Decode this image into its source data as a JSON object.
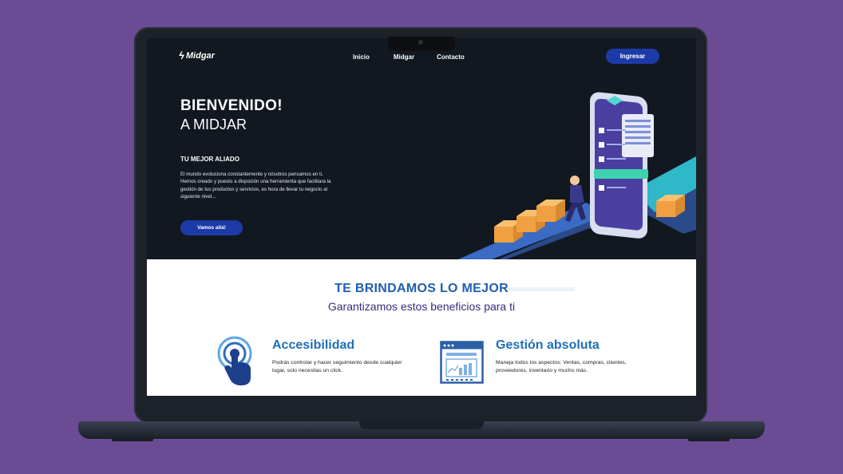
{
  "nav": {
    "logo": "Midgar",
    "links": [
      "Inicio",
      "Midgar",
      "Contacto"
    ],
    "login_button": "Ingresar"
  },
  "hero": {
    "title": "BIENVENIDO!",
    "subtitle": "A MIDJAR",
    "kicker": "TU MEJOR ALIADO",
    "body": "El mundo evoluciona constantemente y nósotros pensamos en ti. Hemos creado y puesto a dispoción una herramienta que facilitara la gestión de tus productos y servicios, es hora de llevar tu negocio al siguiente nivel...",
    "cta": "Vamos allá!"
  },
  "benefits": {
    "title": "TE BRINDAMOS LO MEJOR",
    "subtitle": "Garantizamos estos beneficios para ti",
    "features": [
      {
        "icon": "touch-icon",
        "title": "Accesibilidad",
        "description": "Podrás controlar y hacer seguimiento desde cualquier lugar, solo necesitas un click."
      },
      {
        "icon": "dashboard-chart-icon",
        "title": "Gestión absoluta",
        "description": "Maneja todos los aspectos: Ventas, compras, clientes, proveedores, inventario y mucho más."
      }
    ]
  },
  "colors": {
    "background": "#6a4b94",
    "hero_bg": "#111820",
    "accent_button": "#1c3ba8",
    "benefit_title": "#1e5fb0",
    "benefit_subtitle": "#3a2a7a"
  }
}
